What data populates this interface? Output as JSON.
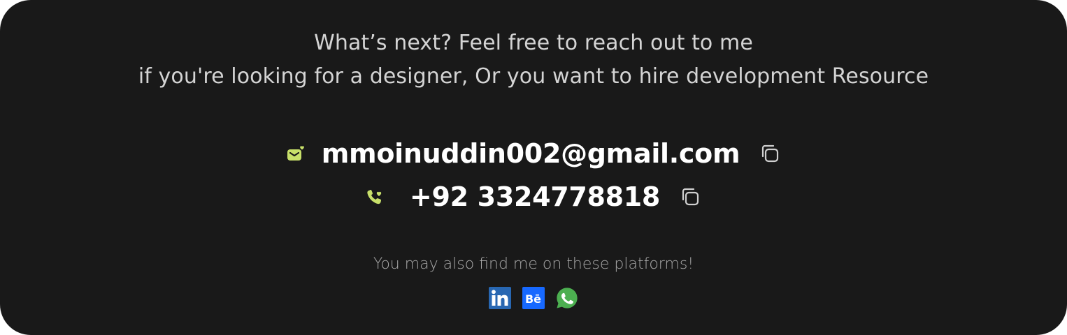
{
  "intro": {
    "line1": "What’s next? Feel free to reach out to me",
    "line2": "if you're looking for a designer, Or you want to hire development Resource"
  },
  "contact": {
    "email": {
      "icon": "mail-heart-icon",
      "value": "mmoinuddin002@gmail.com",
      "copy_icon": "copy-icon"
    },
    "phone": {
      "icon": "phone-heart-icon",
      "value": "+92 3324778818",
      "copy_icon": "copy-icon"
    }
  },
  "platforms": {
    "text": "You may also find me on these platforms!",
    "items": [
      {
        "name": "linkedin",
        "icon": "linkedin-icon",
        "color": "#2867B2"
      },
      {
        "name": "behance",
        "icon": "behance-icon",
        "color": "#1769FF"
      },
      {
        "name": "whatsapp",
        "icon": "whatsapp-icon",
        "color": "#4CAF50"
      }
    ]
  },
  "colors": {
    "background": "#191919",
    "accent": "#C8E06A",
    "text_primary": "#FFFFFF",
    "text_secondary": "#D4D4D4",
    "text_muted": "#A8A8A8"
  }
}
